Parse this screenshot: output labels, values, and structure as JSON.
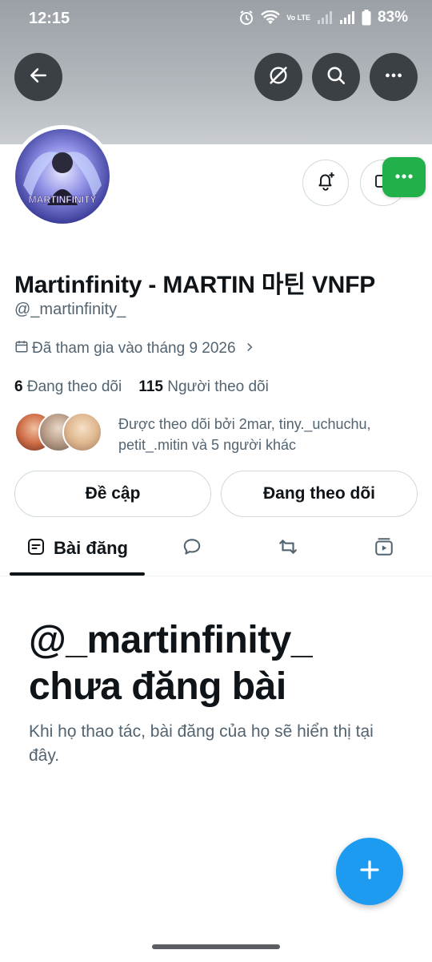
{
  "status_bar": {
    "time": "12:15",
    "battery": "83%",
    "network_label": "Vo LTE"
  },
  "profile": {
    "avatar_text": "MARTINFINITY",
    "name": "Martinfinity - MARTIN 마틴 VNFP",
    "handle": "@_martinfinity_",
    "joined": "Đã tham gia vào tháng 9 2026",
    "following_count": "6",
    "following_label": "Đang theo dõi",
    "followers_count": "115",
    "followers_label": "Người theo dõi",
    "followed_by_text": "Được theo dõi bởi 2mar, tiny._uchuchu, petit_.mitin và 5 người khác"
  },
  "actions": {
    "mention_label": "Đề cập",
    "following_label": "Đang theo dõi"
  },
  "tabs": [
    {
      "label": "Bài đăng",
      "icon": "posts-icon",
      "active": true
    },
    {
      "label": "",
      "icon": "replies-icon",
      "active": false
    },
    {
      "label": "",
      "icon": "reposts-icon",
      "active": false
    },
    {
      "label": "",
      "icon": "media-icon",
      "active": false
    }
  ],
  "empty_state": {
    "title": "@_martinfinity_ chưa đăng bài",
    "subtitle": "Khi họ thao tác, bài đăng của họ sẽ hiển thị tại đây."
  },
  "colors": {
    "accent": "#1d9bf0",
    "green_chat": "#21b04a",
    "text_primary": "#0f1419",
    "text_secondary": "#536471"
  }
}
